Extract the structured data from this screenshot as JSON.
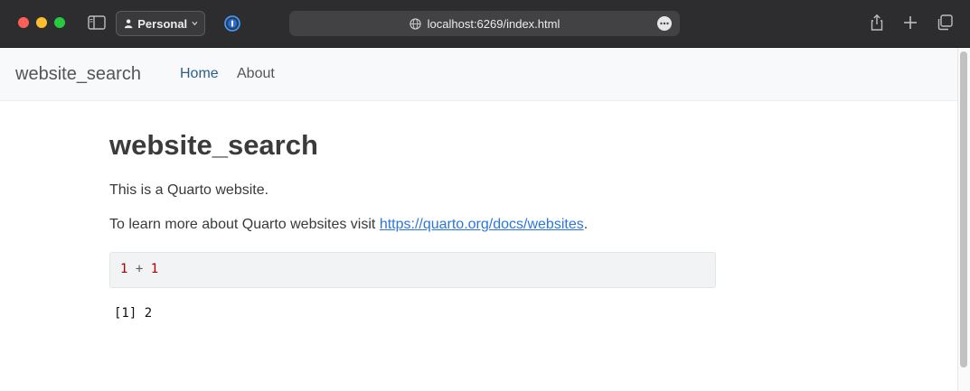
{
  "browser": {
    "profile_label": "Personal",
    "url": "localhost:6269/index.html",
    "icons": [
      "sidebar-icon",
      "person-icon",
      "chevron-down-icon",
      "password-manager-icon",
      "globe-icon",
      "more-icon",
      "share-icon",
      "plus-icon",
      "tabs-icon"
    ],
    "traffic_colors": {
      "close": "#fe5f57",
      "minimize": "#febc2e",
      "zoom": "#28c840"
    }
  },
  "navbar": {
    "brand": "website_search",
    "links": [
      {
        "label": "Home",
        "active": true
      },
      {
        "label": "About",
        "active": false
      }
    ]
  },
  "content": {
    "title": "website_search",
    "para1": "This is a Quarto website.",
    "para2_prefix": "To learn more about Quarto websites visit ",
    "para2_link": "https://quarto.org/docs/websites",
    "para2_suffix": ".",
    "code": {
      "left": "1",
      "op": " + ",
      "right": "1"
    },
    "output": "[1] 2"
  },
  "colors": {
    "accent_link": "#2a76dd",
    "nav_active": "#2f5d8a",
    "code_number": "#ad0000"
  }
}
